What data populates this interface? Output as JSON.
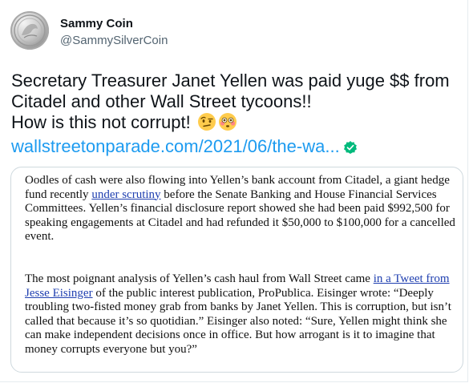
{
  "author": {
    "display_name": "Sammy Coin",
    "handle": "@SammySilverCoin"
  },
  "tweet": {
    "line1": "Secretary Treasurer Janet Yellen was paid yuge $$ from",
    "line2": "Citadel and other Wall Street tycoons!!",
    "line3": "How is this not corrupt!",
    "emojis": [
      "face-with-raised-eyebrow-emoji",
      "flushed-face-emoji"
    ],
    "link_text": "wallstreetonparade.com/2021/06/the-wa...",
    "link_badge_icon": "verified-check-icon"
  },
  "embed": {
    "para1": {
      "before_link": "Oodles of cash were also flowing into Yellen’s bank account from Citadel, a giant hedge fund recently ",
      "link": "under scrutiny",
      "after_link": " before the Senate Banking and House Financial Services Committees. Yellen’s financial disclosure report showed she had been paid $992,500 for speaking engagements at Citadel and had refunded it $50,000 to $100,000 for a cancelled event."
    },
    "para2": {
      "before_link": "The most poignant analysis of Yellen’s cash haul from Wall Street came ",
      "link": "in a Tweet from Jesse Eisinger",
      "after_link": " of the public interest publication, ProPublica. Eisinger wrote: “Deeply troubling two-fisted money grab from banks by Janet Yellen. This is corruption, but isn’t called that because it’s so quotidian.” Eisinger also noted: “Sure, Yellen might think she can make independent decisions once in office. But how arrogant is it to imagine that money corrupts everyone but you?”"
    }
  },
  "colors": {
    "text": "#0f1419",
    "muted": "#536471",
    "link": "#1d9bf0",
    "border": "#cfd9de",
    "verified_green": "#00ba7c"
  }
}
